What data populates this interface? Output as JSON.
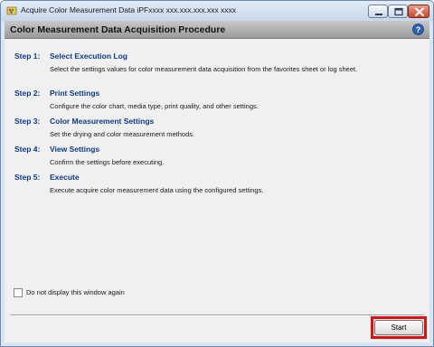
{
  "window": {
    "title": "Acquire Color Measurement Data iPFxxxx xxx.xxx.xxx.xxx xxxx",
    "icons": [
      "app-icon",
      "minimize-icon",
      "maximize-icon",
      "close-icon"
    ]
  },
  "header": {
    "title": "Color Measurement Data Acquisition Procedure",
    "help_icon": "help-icon"
  },
  "steps": [
    {
      "number": "Step 1:",
      "title": "Select Execution Log",
      "description": "Select the settings values for color measurement data acquisition from the favorites sheet or log sheet."
    },
    {
      "number": "Step 2:",
      "title": "Print Settings",
      "description": "Configure the color chart, media type, print quality, and other settings."
    },
    {
      "number": "Step 3:",
      "title": "Color Measurement Settings",
      "description": "Set the drying and color measurement methods."
    },
    {
      "number": "Step 4:",
      "title": "View Settings",
      "description": "Confirm the settings before executing."
    },
    {
      "number": "Step 5:",
      "title": "Execute",
      "description": "Execute acquire color measurement data using the configured settings."
    }
  ],
  "footer": {
    "checkbox_label": "Do not display this window again",
    "checkbox_checked": false,
    "start_label": "Start"
  },
  "colors": {
    "step_heading": "#0b3a8c",
    "highlight": "#e01010"
  }
}
